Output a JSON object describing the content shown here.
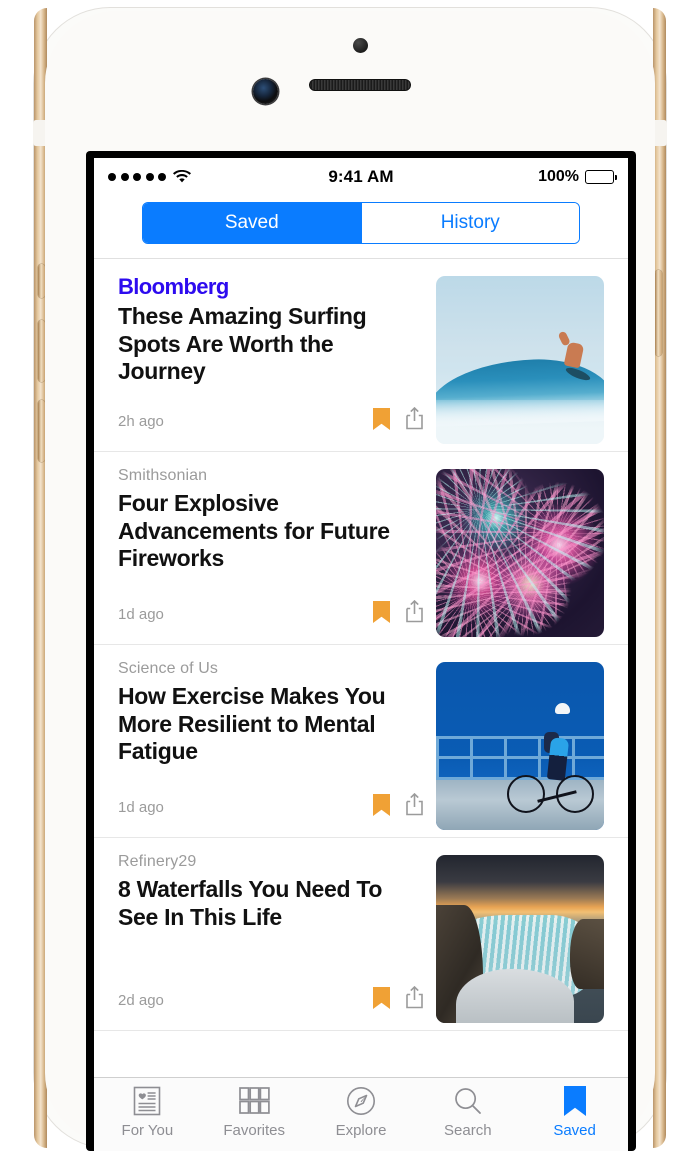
{
  "status_bar": {
    "signal_dots": 5,
    "wifi_icon": "wifi-icon",
    "time": "9:41 AM",
    "battery_percent": "100%",
    "battery_icon": "battery-full-icon"
  },
  "segmented_control": {
    "options": [
      {
        "label": "Saved",
        "active": true
      },
      {
        "label": "History",
        "active": false
      }
    ],
    "active_color": "#0a7cff"
  },
  "articles": [
    {
      "publisher": "Bloomberg",
      "publisher_style": "logo",
      "publisher_color": "#2d0bef",
      "headline": "These Amazing Surfing Spots Are Worth the Journey",
      "timestamp": "2h ago",
      "bookmark_icon": "bookmark-icon",
      "bookmark_color": "#f0a135",
      "share_icon": "share-icon",
      "thumbnail": "surfer-riding-wave"
    },
    {
      "publisher": "Smithsonian",
      "publisher_style": "text",
      "publisher_color": "#9b9b9b",
      "headline": "Four Explosive Advancements for Future Fireworks",
      "timestamp": "1d ago",
      "bookmark_icon": "bookmark-icon",
      "bookmark_color": "#f0a135",
      "share_icon": "share-icon",
      "thumbnail": "fireworks-night-sky"
    },
    {
      "publisher": "Science of Us",
      "publisher_style": "text",
      "publisher_color": "#9b9b9b",
      "headline": "How Exercise Makes You More Resilient to Mental Fatigue",
      "timestamp": "1d ago",
      "bookmark_icon": "bookmark-icon",
      "bookmark_color": "#f0a135",
      "share_icon": "share-icon",
      "thumbnail": "cyclist-on-bridge"
    },
    {
      "publisher": "Refinery29",
      "publisher_style": "text",
      "publisher_color": "#9b9b9b",
      "headline": "8 Waterfalls You Need To See In This Life",
      "timestamp": "2d ago",
      "bookmark_icon": "bookmark-icon",
      "bookmark_color": "#f0a135",
      "share_icon": "share-icon",
      "thumbnail": "waterfall-at-sunset"
    }
  ],
  "tab_bar": {
    "items": [
      {
        "label": "For You",
        "icon": "document-heart-icon",
        "active": false
      },
      {
        "label": "Favorites",
        "icon": "grid-icon",
        "active": false
      },
      {
        "label": "Explore",
        "icon": "compass-icon",
        "active": false
      },
      {
        "label": "Search",
        "icon": "search-icon",
        "active": false
      },
      {
        "label": "Saved",
        "icon": "bookmark-icon",
        "active": true
      }
    ],
    "active_color": "#0a7cff",
    "inactive_color": "#8e8e93"
  },
  "device": {
    "body_color": "#fbfaf8",
    "rail_color": "#d8b88c",
    "sensors": [
      "proximity-sensor",
      "front-camera",
      "earpiece-speaker"
    ],
    "buttons": [
      "silent-switch",
      "volume-up",
      "volume-down",
      "power-button"
    ]
  }
}
